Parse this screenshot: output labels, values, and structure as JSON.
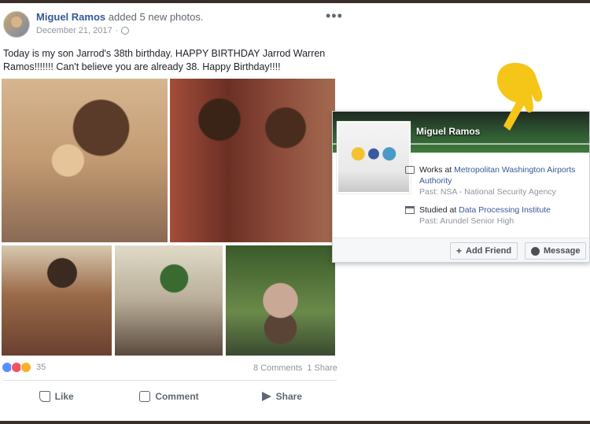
{
  "post": {
    "author": "Miguel Ramos",
    "action": "added 5 new photos.",
    "date": "December 21, 2017",
    "date_sep": "·",
    "more": "•••",
    "text": "Today is my son Jarrod's 38th birthday. HAPPY BIRTHDAY Jarrod Warren Ramos!!!!!!! Can't believe you are already 38. Happy Birthday!!!!",
    "photo_count": 5
  },
  "engagement": {
    "reaction_count": "35",
    "comments": "8 Comments",
    "shares": "1 Share",
    "reaction_types": [
      "like",
      "love",
      "wow"
    ]
  },
  "actions": {
    "like": "Like",
    "comment": "Comment",
    "share": "Share"
  },
  "hovercard": {
    "name": "Miguel Ramos",
    "work_prefix": "Works at ",
    "work_place": "Metropolitan Washington Airports Authority",
    "work_past": "Past: NSA - National Security Agency",
    "edu_prefix": "Studied at ",
    "edu_place": "Data Processing Institute",
    "edu_past": "Past: Arundel Senior High",
    "add_friend": "Add Friend",
    "message": "Message"
  },
  "colors": {
    "link": "#365899",
    "muted": "#90949c",
    "accent_hand": "#f5c518"
  },
  "icons": [
    "globe-icon",
    "more-icon",
    "like-icon",
    "comment-icon",
    "share-icon",
    "briefcase-icon",
    "graduation-icon",
    "add-friend-icon",
    "messenger-icon",
    "pointing-hand-icon"
  ]
}
